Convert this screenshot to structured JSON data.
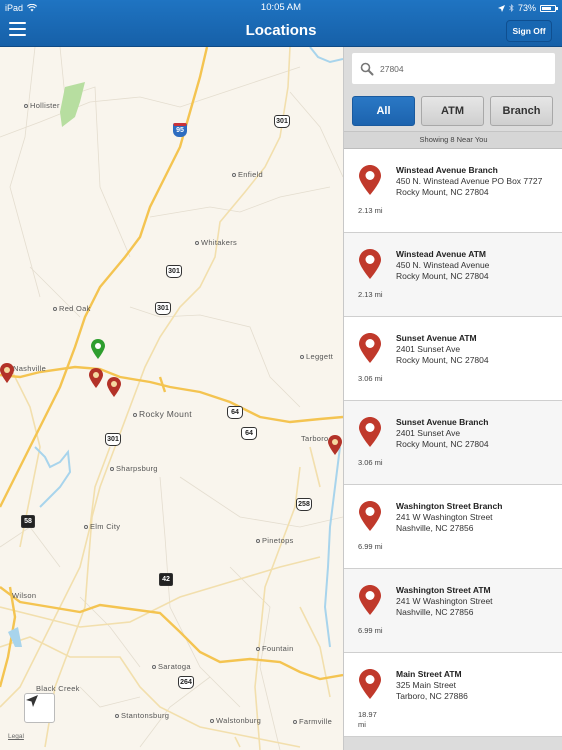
{
  "status_bar": {
    "device": "iPad",
    "time": "10:05 AM",
    "battery": "73%",
    "battery_level": 0.73
  },
  "header": {
    "title": "Locations",
    "menu_icon": "hamburger-icon",
    "sign_off_label": "Sign Off"
  },
  "colors": {
    "header_blue": "#1f74c2",
    "pin_red": "#c0392b",
    "pin_green": "#2e9e2e",
    "active_filter": "#2a78c5"
  },
  "search": {
    "value": "27804",
    "placeholder": "",
    "icon": "search-icon"
  },
  "filters": [
    {
      "label": "All",
      "active": true
    },
    {
      "label": "ATM",
      "active": false
    },
    {
      "label": "Branch",
      "active": false
    }
  ],
  "results_summary": "Showing 8 Near You",
  "locations": [
    {
      "name": "Winstead Avenue Branch",
      "address1": "450 N. Winstead Avenue PO Box 7727",
      "address2": "Rocky Mount, NC 27804",
      "distance": "2.13 mi"
    },
    {
      "name": "Winstead Avenue ATM",
      "address1": "450 N. Winstead Avenue",
      "address2": "Rocky Mount, NC 27804",
      "distance": "2.13 mi"
    },
    {
      "name": "Sunset Avenue ATM",
      "address1": "2401 Sunset Ave",
      "address2": "Rocky Mount, NC 27804",
      "distance": "3.06 mi"
    },
    {
      "name": "Sunset Avenue Branch",
      "address1": "2401 Sunset Ave",
      "address2": "Rocky Mount, NC 27804",
      "distance": "3.06 mi"
    },
    {
      "name": "Washington Street Branch",
      "address1": "241 W Washington Street",
      "address2": "Nashville, NC 27856",
      "distance": "6.99 mi"
    },
    {
      "name": "Washington Street ATM",
      "address1": "241 W Washington Street",
      "address2": "Nashville, NC 27856",
      "distance": "6.99 mi"
    },
    {
      "name": "Main Street ATM",
      "address1": "325 Main Street",
      "address2": "Tarboro, NC 27886",
      "distance": "18.97 mi"
    }
  ],
  "map": {
    "places": [
      "Hollister",
      "Enfield",
      "Whitakers",
      "Red Oak",
      "Nashville",
      "Leggett",
      "Rocky Mount",
      "Tarboro",
      "Sharpsburg",
      "Elm City",
      "Pinetops",
      "Wilson",
      "Fountain",
      "Saratoga",
      "Black Creek",
      "Stantonsburg",
      "Walstonburg",
      "Farmville"
    ],
    "shields": {
      "i95": "95",
      "us301_a": "301",
      "us301_b": "301",
      "us301_c": "301",
      "us301_d": "301",
      "us64_a": "64",
      "us64_b": "64",
      "us258": "258",
      "nc58": "58",
      "nc42": "42",
      "us264": "264"
    },
    "legal_label": "Legal",
    "locate_icon": "location-arrow-icon"
  }
}
